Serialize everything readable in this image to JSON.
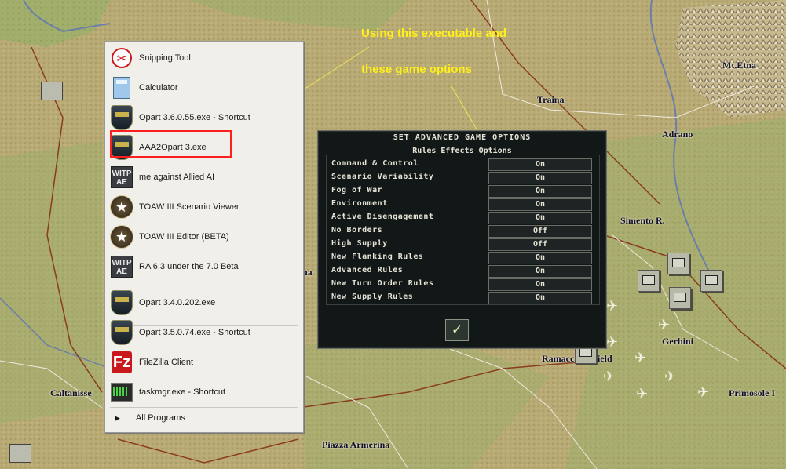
{
  "map": {
    "places": [
      {
        "id": "mt-etna",
        "label": "Mt.Etna"
      },
      {
        "id": "traina",
        "label": "Traina"
      },
      {
        "id": "adrano",
        "label": "Adrano"
      },
      {
        "id": "simento",
        "label": "Simento R."
      },
      {
        "id": "gerbini",
        "label": "Gerbini"
      },
      {
        "id": "ramacca",
        "label": "Ramacca Airfield"
      },
      {
        "id": "primosole",
        "label": "Primosole I"
      },
      {
        "id": "caltanissetta",
        "label": "Caltanisse"
      },
      {
        "id": "piazza",
        "label": "Piazza Armerina"
      },
      {
        "id": "partial-na",
        "label": "na"
      }
    ]
  },
  "annotations": {
    "line1": "Using this executable and",
    "line2": "these game options"
  },
  "start_menu": {
    "items": [
      {
        "label": "Snipping Tool",
        "icon": "snipping-tool-icon"
      },
      {
        "label": "Calculator",
        "icon": "calculator-icon"
      },
      {
        "label": "Opart 3.6.0.55.exe - Shortcut",
        "icon": "operational-art-icon"
      },
      {
        "label": "AAA2Opart 3.exe",
        "icon": "operational-art-icon"
      },
      {
        "label": "me against Allied AI",
        "icon": "witp-ae-icon"
      },
      {
        "label": "TOAW III Scenario Viewer",
        "icon": "toaw-star-icon"
      },
      {
        "label": "TOAW III  Editor (BETA)",
        "icon": "toaw-star-icon"
      },
      {
        "label": "RA 6.3 under the 7.0 Beta",
        "icon": "witp-ae-icon"
      },
      {
        "label": "Opart 3.4.0.202.exe",
        "icon": "operational-art-icon"
      },
      {
        "label": "Opart 3.5.0.74.exe - Shortcut",
        "icon": "operational-art-icon"
      },
      {
        "label": "FileZilla Client",
        "icon": "filezilla-icon"
      },
      {
        "label": "taskmgr.exe - Shortcut",
        "icon": "task-manager-icon"
      }
    ],
    "all_programs": "All Programs",
    "witp_text": "WITP AE",
    "filezilla_text": "Fz"
  },
  "dialog": {
    "title": "SET ADVANCED GAME OPTIONS",
    "subtitle": "Rules Effects Options",
    "options": [
      {
        "label": "Command & Control",
        "value": "On"
      },
      {
        "label": "Scenario Variability",
        "value": "On"
      },
      {
        "label": "Fog of War",
        "value": "On"
      },
      {
        "label": "Environment",
        "value": "On"
      },
      {
        "label": "Active Disengagement",
        "value": "On"
      },
      {
        "label": "No Borders",
        "value": "Off"
      },
      {
        "label": "High Supply",
        "value": "Off"
      },
      {
        "label": "New Flanking Rules",
        "value": "On"
      },
      {
        "label": "Advanced Rules",
        "value": "On"
      },
      {
        "label": "New Turn Order Rules",
        "value": "On"
      },
      {
        "label": "New Supply Rules",
        "value": "On"
      }
    ],
    "ok_symbol": "✓"
  },
  "colors": {
    "annotation": "#ffef1a",
    "highlight": "#ff1f1f",
    "dialog_bg": "#121717"
  }
}
